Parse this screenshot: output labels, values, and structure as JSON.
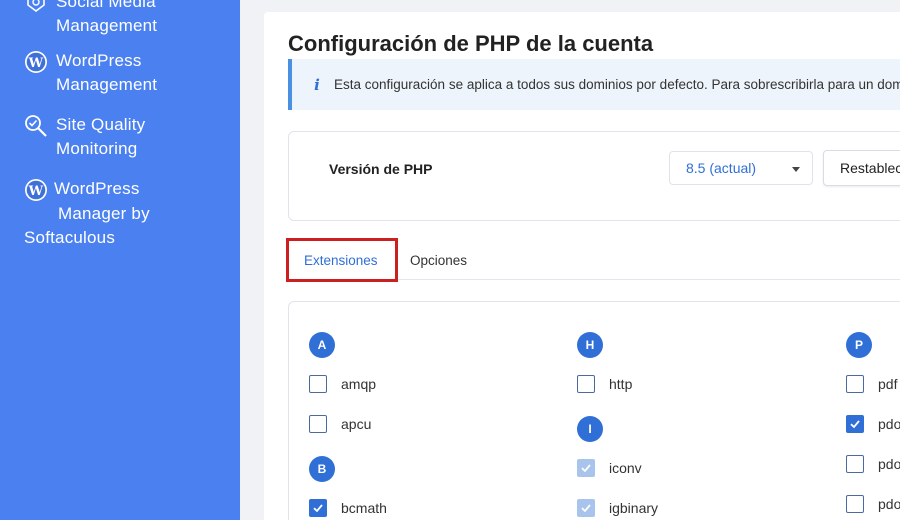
{
  "sidebar": {
    "items": [
      {
        "label": "Social Media Management",
        "icon": "social-media-icon"
      },
      {
        "label": "WordPress Management",
        "icon": "wordpress-icon"
      },
      {
        "label": "Site Quality Monitoring",
        "icon": "site-quality-icon"
      },
      {
        "label": "WordPress Manager by Softaculous",
        "icon": "wordpress-icon"
      }
    ],
    "social_line1": "Social Media",
    "social_line2": "Management",
    "wp_line1": "WordPress",
    "wp_line2": "Management",
    "sq_line1": "Site Quality",
    "sq_line2": "Monitoring",
    "wps_line1": "WordPress",
    "wps_line2": "Manager by",
    "wps_line3": "Softaculous"
  },
  "main": {
    "title": "Configuración de PHP de la cuenta",
    "info_text": "Esta configuración se aplica a todos sus dominios por defecto. Para sobrescribirla para un domi",
    "php_version_label": "Versión de PHP",
    "php_version_selected": "8.5 (actual)",
    "reset_button": "Restablec",
    "tabs": [
      {
        "label": "Extensiones",
        "active": true
      },
      {
        "label": "Opciones",
        "active": false
      }
    ]
  },
  "extensions": {
    "groups": [
      {
        "letter": "A",
        "items": [
          {
            "name": "amqp",
            "state": "unchecked"
          },
          {
            "name": "apcu",
            "state": "unchecked"
          }
        ]
      },
      {
        "letter": "B",
        "items": [
          {
            "name": "bcmath",
            "state": "checked"
          }
        ]
      },
      {
        "letter": "H",
        "items": [
          {
            "name": "http",
            "state": "unchecked"
          }
        ]
      },
      {
        "letter": "I",
        "items": [
          {
            "name": "iconv",
            "state": "checked-disabled"
          },
          {
            "name": "igbinary",
            "state": "checked-disabled"
          }
        ]
      },
      {
        "letter": "P",
        "items": [
          {
            "name": "pdf",
            "state": "unchecked"
          },
          {
            "name": "pdo",
            "state": "checked"
          },
          {
            "name": "pdo_",
            "state": "unchecked"
          },
          {
            "name": "pdo_",
            "state": "unchecked"
          }
        ]
      }
    ]
  },
  "colors": {
    "sidebar_bg": "#4a80f0",
    "accent": "#2f6fd6",
    "highlight": "#cc1f1f"
  }
}
